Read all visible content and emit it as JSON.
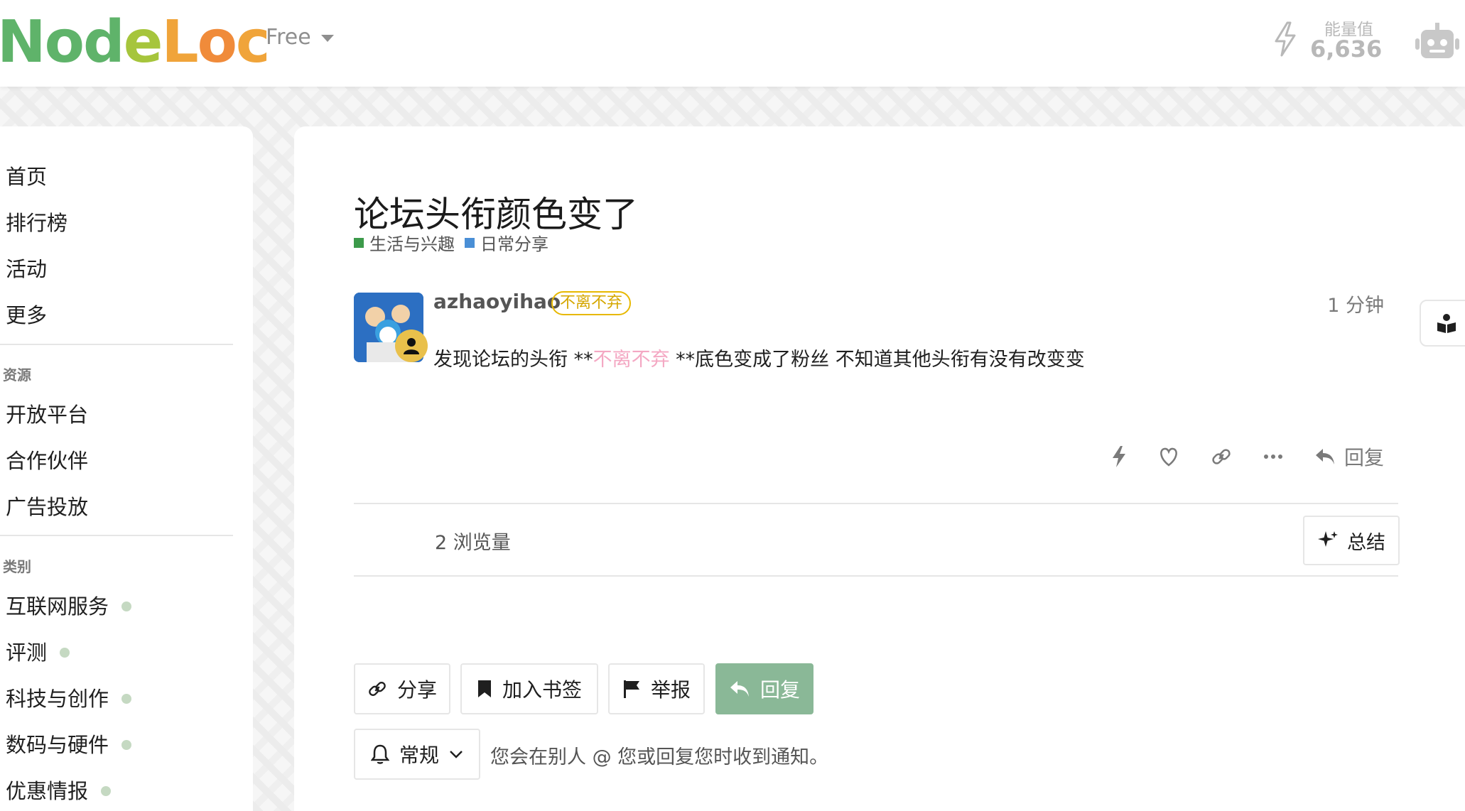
{
  "header": {
    "logo_letters": [
      {
        "ch": "N",
        "color": "#5fb36a"
      },
      {
        "ch": "o",
        "color": "#5fb36a"
      },
      {
        "ch": "d",
        "color": "#5fb36a"
      },
      {
        "ch": "e",
        "color": "#a6c53c"
      },
      {
        "ch": "L",
        "color": "#f0a43a"
      },
      {
        "ch": "o",
        "color": "#f08b3a"
      },
      {
        "ch": "c",
        "color": "#f0a43a"
      }
    ],
    "plan": "Free",
    "energy_label": "能量值",
    "energy_value": "6,636"
  },
  "sidebar": {
    "top_items": [
      "首页",
      "排行榜",
      "活动",
      "更多"
    ],
    "resources_heading": "资源",
    "resource_items": [
      "开放平台",
      "合作伙伴",
      "广告投放"
    ],
    "categories_heading": "类别",
    "category_items": [
      "互联网服务",
      "评测",
      "科技与创作",
      "数码与硬件",
      "优惠情报"
    ],
    "category_dot_color": "#c5d9c2"
  },
  "topic": {
    "title": "论坛头衔颜色变了",
    "breadcrumbs": [
      {
        "label": "生活与兴趣",
        "color": "#3c9a4a"
      },
      {
        "label": "日常分享",
        "color": "#4a8fd6"
      }
    ]
  },
  "post": {
    "username": "azhaoyihao",
    "user_title": "不离不弃",
    "time": "1 分钟",
    "body_before": "发现论坛的头衔 **",
    "body_highlight": "不离不弃",
    "body_after": " **底色变成了粉丝 不知道其他头衔有没有改变变",
    "reply_label": "回复"
  },
  "stats": {
    "views": "2 浏览量",
    "summary_label": "总结"
  },
  "footer_buttons": {
    "share": "分享",
    "bookmark": "加入书签",
    "flag": "举报",
    "reply": "回复",
    "accent": "#8ab897"
  },
  "notifications": {
    "level": "常规",
    "description": "您会在别人 @ 您或回复您时收到通知。"
  }
}
